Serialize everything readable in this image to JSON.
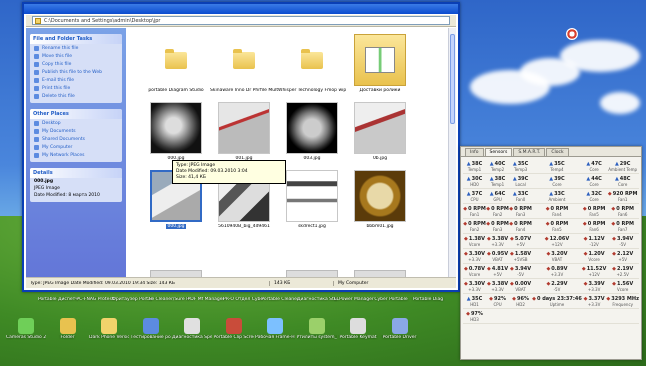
{
  "explorer": {
    "address": "C:\\Documents and Settings\\admin\\Desktop\\jpr",
    "task_groups": [
      {
        "title": "File and Folder Tasks",
        "items": [
          "Rename this file",
          "Move this file",
          "Copy this file",
          "Publish this file to the Web",
          "E-mail this file",
          "Print this file",
          "Delete this file"
        ]
      },
      {
        "title": "Other Places",
        "items": [
          "Desktop",
          "My Documents",
          "Shared Documents",
          "My Computer",
          "My Network Places"
        ]
      },
      {
        "title": "Details",
        "items": [
          "000.jpg",
          "JPEG Image",
          "Date Modified: 8 марта 2010"
        ]
      }
    ],
    "files": [
      {
        "name": "portable Diagram Studio",
        "kind": "folder"
      },
      {
        "name": "Skinaware Inno Dr Phrfile Multiline on the",
        "kind": "folder"
      },
      {
        "name": "Whisper Technology Fmop wiper Studi",
        "kind": "folder"
      },
      {
        "name": "Доставки ролики",
        "kind": "folder-special"
      },
      {
        "name": "000.jpg",
        "kind": "photo-round"
      },
      {
        "name": "001.jpg",
        "kind": "photo-road"
      },
      {
        "name": "003.jpg",
        "kind": "photo-round2"
      },
      {
        "name": "0b.jpg",
        "kind": "photo-road2"
      },
      {
        "name": "000.jpg",
        "kind": "photo-road3"
      },
      {
        "name": "5610940B_big_4d9461",
        "kind": "photo-people"
      },
      {
        "name": "skdrect1.jpg",
        "kind": "photo-doc"
      },
      {
        "name": "bbbm01.jpg",
        "kind": "photo-frame"
      }
    ],
    "tooltip": [
      "Type: JPEG Image",
      "Date Modified: 09.03.2010 3:04",
      "Size: 41,4 КБ"
    ],
    "status": {
      "left": "Type: JPEG Image Date Modified: 09.03.2010 19:34 Size: 143 КБ",
      "size": "143 КБ",
      "zone": "My Computer"
    }
  },
  "gadget": {
    "tabs": [
      "Info",
      "Sensors",
      "S.M.A.R.T.",
      "Clock"
    ],
    "active_tab": 1,
    "rows": [
      [
        [
          "38C",
          "Temp1"
        ],
        [
          "40C",
          "Temp2"
        ],
        [
          "35C",
          "Temp3"
        ],
        [
          "35C",
          "Temp4"
        ],
        [
          "47C",
          "Core"
        ],
        [
          "29C",
          "Ambient Temp"
        ]
      ],
      [
        [
          "30C",
          "HD0"
        ],
        [
          "38C",
          "Temp1"
        ],
        [
          "39C",
          "Local"
        ],
        [
          "39C",
          "Core"
        ],
        [
          "44C",
          "Core"
        ],
        [
          "48C",
          "Core"
        ]
      ],
      [
        [
          "37C",
          "CPU"
        ],
        [
          "64C",
          "GPU"
        ],
        [
          "33C",
          "Fan0"
        ],
        [
          "33C",
          "Ambient"
        ],
        [
          "32C",
          "Core"
        ],
        [
          "920 RPM",
          "Fan1"
        ]
      ],
      [
        [
          "0 RPM",
          "Fan1"
        ],
        [
          "0 RPM",
          "Fan2"
        ],
        [
          "0 RPM",
          "Fan3"
        ],
        [
          "0 RPM",
          "Fan4"
        ],
        [
          "0 RPM",
          "Fan5"
        ],
        [
          "0 RPM",
          "Fan6"
        ]
      ],
      [
        [
          "0 RPM",
          "Fan2"
        ],
        [
          "0 RPM",
          "Fan3"
        ],
        [
          "0 RPM",
          "Fan4"
        ],
        [
          "0 RPM",
          "Fan5"
        ],
        [
          "0 RPM",
          "Fan6"
        ],
        [
          "0 RPM",
          "Fan7"
        ]
      ],
      [
        [
          "1.38V",
          "Vcore"
        ],
        [
          "3.38V",
          "+3.3V"
        ],
        [
          "5.07V",
          "+5V"
        ],
        [
          "12.06V",
          "+12V"
        ],
        [
          "1.12V",
          "-12V"
        ],
        [
          "3.94V",
          "-5V"
        ]
      ],
      [
        [
          "3.30V",
          "+3.3V"
        ],
        [
          "0.95V",
          "VBAT"
        ],
        [
          "1.58V",
          "+5VSB"
        ],
        [
          "3.20V",
          "VBAT"
        ],
        [
          "1.20V",
          "Vcore"
        ],
        [
          "2.12V",
          "+5V"
        ]
      ],
      [
        [
          "0.78V",
          "Vcore"
        ],
        [
          "4.81V",
          "+5V"
        ],
        [
          "3.94V",
          "-5V"
        ],
        [
          "0.89V",
          "+3.3V"
        ],
        [
          "11.52V",
          "+12V"
        ],
        [
          "2.19V",
          "+2.5V"
        ]
      ],
      [
        [
          "3.30V",
          "+3.3V"
        ],
        [
          "3.38V",
          "+3.3V"
        ],
        [
          "0.00V",
          "VBAT"
        ],
        [
          "2.29V",
          "-5V"
        ],
        [
          "3.39V",
          "+3.3V"
        ],
        [
          "1.56V",
          "Vcore"
        ]
      ],
      [
        [
          "35C",
          "HD1"
        ],
        [
          "92%",
          "CPU"
        ],
        [
          "96%",
          "HD2"
        ],
        [
          "0 days 23:37:46",
          "Uptime"
        ],
        [
          "3.37V",
          "+3.3V"
        ],
        [
          "3293 MHz",
          "Frequency"
        ]
      ],
      [
        [
          "97%",
          "HD3"
        ],
        [
          "",
          "",
          ""
        ],
        [
          "",
          "",
          ""
        ],
        [
          "",
          "",
          ""
        ],
        [
          "",
          "",
          ""
        ],
        [
          "",
          "",
          ""
        ]
      ]
    ]
  },
  "desktop": {
    "icons": [
      "Portable Диспетчер Studio",
      "PC-FNAG Protest",
      "Фритаузер Portable 10.1",
      "Fe Cleaner/Sure Portable Studio",
      "PDF Mf Manager",
      "PR-O Отдел Cyber Pro",
      "Portable Cleaner",
      "Диагностика Studio",
      "LLPower Manager 3.0",
      "Cyber Portable",
      "Portable Diag",
      "Cameras Studio 2",
      "Folder",
      "Dark Phone Version 2",
      "Тестирование portable",
      "Диагностика SpeedFan",
      "Portable Clip Screen",
      "Рабочая Frame-Hr",
      "Утилиты system_cat",
      "Portable Keymat",
      "Portable Driver"
    ]
  }
}
